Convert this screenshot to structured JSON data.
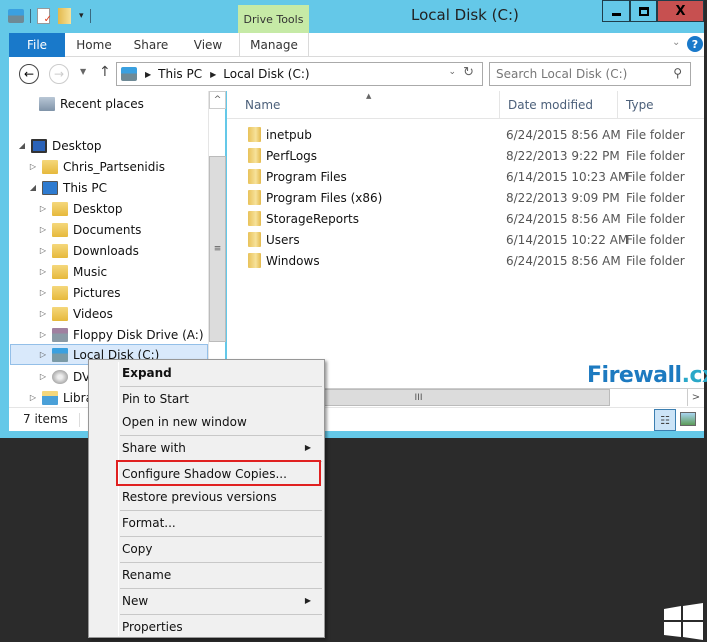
{
  "window": {
    "title": "Local Disk (C:)",
    "contextual_tab_group": "Drive Tools",
    "controls": {
      "minimize": "—",
      "maximize": "□",
      "close": "X"
    }
  },
  "ribbon": {
    "tabs": [
      {
        "label": "File",
        "active": true
      },
      {
        "label": "Home"
      },
      {
        "label": "Share"
      },
      {
        "label": "View"
      },
      {
        "label": "Manage"
      }
    ],
    "collapse_glyph": "⌄",
    "help_glyph": "?"
  },
  "navbar": {
    "back_glyph": "←",
    "forward_glyph": "→",
    "recent_glyph": "▼",
    "up_glyph": "↑",
    "breadcrumb": [
      "This PC",
      "Local Disk (C:)"
    ],
    "crumb_separator": "▶",
    "address_dropdown_glyph": "⌄",
    "refresh_glyph": "↻",
    "search_placeholder": "Search Local Disk (C:)",
    "search_glyph": "⚲"
  },
  "navpane": {
    "items": [
      {
        "label": "Recent places",
        "expander": "",
        "icon": "recent-places-icon"
      },
      {
        "label": "Desktop",
        "expander": "◢",
        "icon": "desktop-icon"
      },
      {
        "label": "Chris_Partsenidis",
        "expander": "▷",
        "icon": "user-folder-icon"
      },
      {
        "label": "This PC",
        "expander": "◢",
        "icon": "computer-icon"
      },
      {
        "label": "Desktop",
        "expander": "▷",
        "icon": "desktop-folder-icon"
      },
      {
        "label": "Documents",
        "expander": "▷",
        "icon": "documents-folder-icon"
      },
      {
        "label": "Downloads",
        "expander": "▷",
        "icon": "downloads-folder-icon"
      },
      {
        "label": "Music",
        "expander": "▷",
        "icon": "music-folder-icon"
      },
      {
        "label": "Pictures",
        "expander": "▷",
        "icon": "pictures-folder-icon"
      },
      {
        "label": "Videos",
        "expander": "▷",
        "icon": "videos-folder-icon"
      },
      {
        "label": "Floppy Disk Drive (A:)",
        "expander": "▷",
        "icon": "floppy-drive-icon"
      },
      {
        "label": "Local Disk (C:)",
        "expander": "▷",
        "icon": "local-disk-icon",
        "selected": true
      },
      {
        "label": "DVD",
        "expander": "▷",
        "icon": "dvd-drive-icon"
      },
      {
        "label": "Libraries",
        "expander": "▷",
        "icon": "libraries-icon"
      }
    ],
    "scroll_up_glyph": "^",
    "scroll_grip_glyph": "≡"
  },
  "content": {
    "columns": {
      "name": "Name",
      "date": "Date modified",
      "type": "Type"
    },
    "sort_glyph": "▲",
    "files": [
      {
        "name": "inetpub",
        "date": "6/24/2015 8:56 AM",
        "type": "File folder"
      },
      {
        "name": "PerfLogs",
        "date": "8/22/2013 9:22 PM",
        "type": "File folder"
      },
      {
        "name": "Program Files",
        "date": "6/14/2015 10:23 AM",
        "type": "File folder"
      },
      {
        "name": "Program Files (x86)",
        "date": "8/22/2013 9:09 PM",
        "type": "File folder"
      },
      {
        "name": "StorageReports",
        "date": "6/24/2015 8:56 AM",
        "type": "File folder"
      },
      {
        "name": "Users",
        "date": "6/14/2015 10:22 AM",
        "type": "File folder"
      },
      {
        "name": "Windows",
        "date": "6/24/2015 8:56 AM",
        "type": "File folder"
      }
    ],
    "watermark": {
      "main": "Firewall",
      "suffix": ".cx"
    },
    "hscroll_grip_glyph": "III",
    "hscroll_right_glyph": ">"
  },
  "statusbar": {
    "items_count": "7 items",
    "details_view_glyph": "☷"
  },
  "context_menu": {
    "items": [
      {
        "label": "Expand",
        "bold": true
      },
      {
        "sep": true
      },
      {
        "label": "Pin to Start"
      },
      {
        "label": "Open in new window"
      },
      {
        "sep": true
      },
      {
        "label": "Share with",
        "submenu": true
      },
      {
        "sep": true
      },
      {
        "label": "Configure Shadow Copies...",
        "highlighted": true
      },
      {
        "label": "Restore previous versions"
      },
      {
        "sep": true
      },
      {
        "label": "Format..."
      },
      {
        "sep": true
      },
      {
        "label": "Copy"
      },
      {
        "sep": true
      },
      {
        "label": "Rename"
      },
      {
        "sep": true
      },
      {
        "label": "New",
        "submenu": true
      },
      {
        "sep": true
      },
      {
        "label": "Properties"
      }
    ],
    "submenu_glyph": "▶",
    "highlight_color": "#e02020"
  },
  "colors": {
    "window_frame": "#64c8e8",
    "file_tab": "#1979ca",
    "drive_tools": "#c6eaa6",
    "close_button": "#c75050",
    "desktop": "#2b2b2b"
  }
}
